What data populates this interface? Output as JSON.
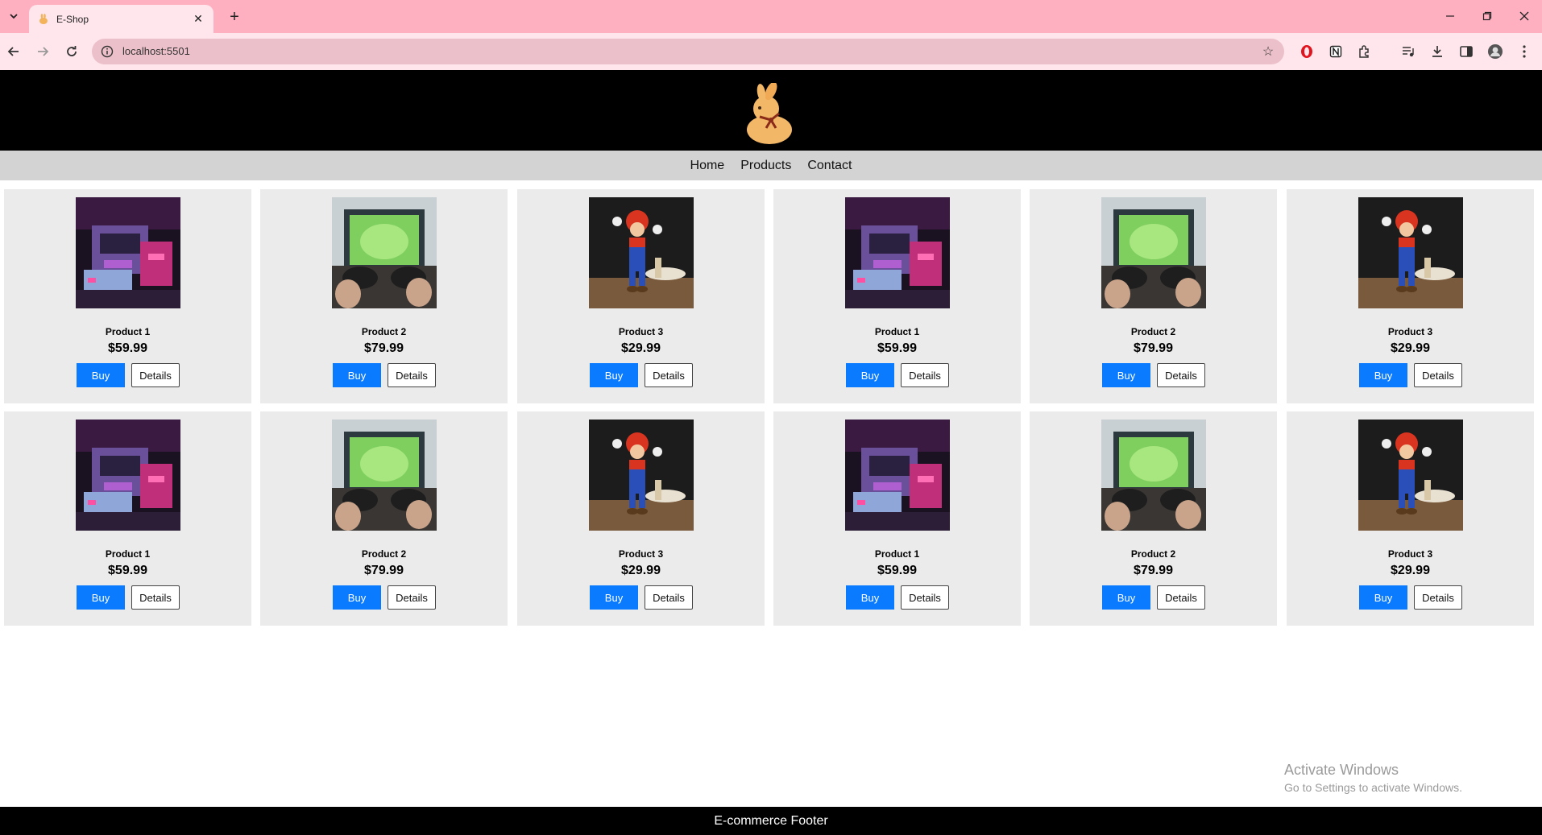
{
  "browser": {
    "tab_title": "E-Shop",
    "url": "localhost:5501"
  },
  "site": {
    "nav": [
      {
        "label": "Home"
      },
      {
        "label": "Products"
      },
      {
        "label": "Contact"
      }
    ],
    "buy_label": "Buy",
    "details_label": "Details",
    "footer": "E-commerce Footer"
  },
  "products": [
    {
      "name": "Product 1",
      "price": "$59.99",
      "image": "retro-console"
    },
    {
      "name": "Product 2",
      "price": "$79.99",
      "image": "gamepad-football"
    },
    {
      "name": "Product 3",
      "price": "$29.99",
      "image": "mario-figure"
    },
    {
      "name": "Product 1",
      "price": "$59.99",
      "image": "retro-console"
    },
    {
      "name": "Product 2",
      "price": "$79.99",
      "image": "gamepad-football"
    },
    {
      "name": "Product 3",
      "price": "$29.99",
      "image": "mario-figure"
    },
    {
      "name": "Product 1",
      "price": "$59.99",
      "image": "retro-console"
    },
    {
      "name": "Product 2",
      "price": "$79.99",
      "image": "gamepad-football"
    },
    {
      "name": "Product 3",
      "price": "$29.99",
      "image": "mario-figure"
    },
    {
      "name": "Product 1",
      "price": "$59.99",
      "image": "retro-console"
    },
    {
      "name": "Product 2",
      "price": "$79.99",
      "image": "gamepad-football"
    },
    {
      "name": "Product 3",
      "price": "$29.99",
      "image": "mario-figure"
    }
  ],
  "watermark": {
    "line1": "Activate Windows",
    "line2": "Go to Settings to activate Windows."
  },
  "colors": {
    "tabstrip": "#ffb0c0",
    "toolbar": "#ffe6ec",
    "buy_button": "#0a7bff",
    "card_bg": "#ebebeb",
    "nav_bg": "#d3d3d3"
  }
}
